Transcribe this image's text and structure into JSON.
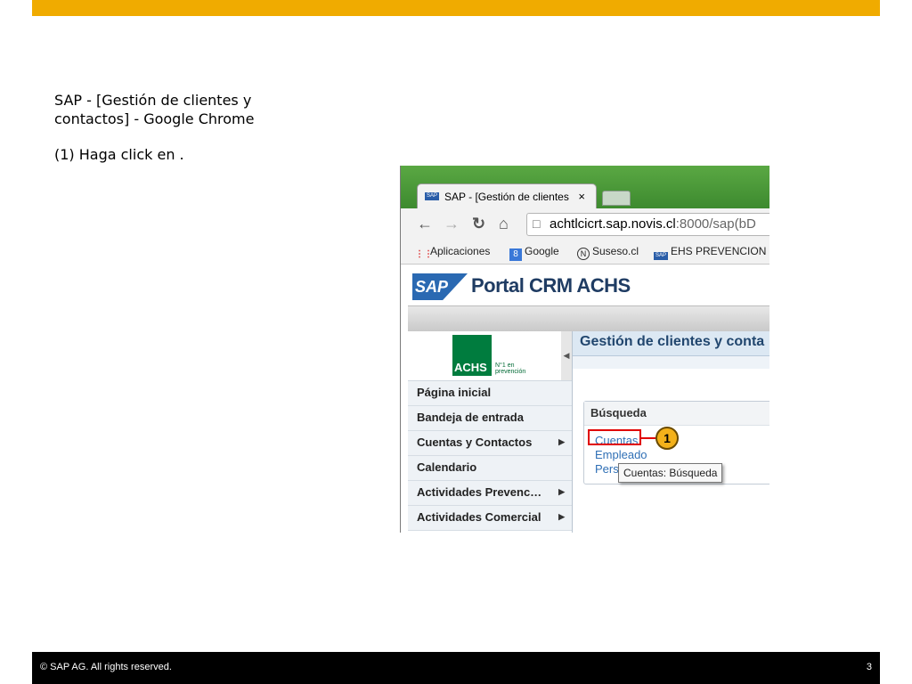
{
  "slide": {
    "title": "SAP - [Gestión de clientes y contactos] - Google Chrome",
    "instruction": "(1) Haga click en .",
    "footer_copyright": "©  SAP AG. All rights reserved.",
    "page_number": "3",
    "accent_color": "#f0ab00"
  },
  "browser": {
    "tab_icon": "SAP",
    "tab_title": "SAP - [Gestión de clientes",
    "tab_close": "×",
    "url_host": "achtlcicrt.sap.novis.cl",
    "url_rest": ":8000/sap(bD",
    "bookmarks": [
      {
        "label": "Aplicaciones",
        "icon": "apps-icon"
      },
      {
        "label": "Google",
        "icon": "google-icon"
      },
      {
        "label": "Suseso.cl",
        "icon": "suseso-icon"
      },
      {
        "label": "EHS PREVENCION",
        "icon": "sap-icon"
      }
    ]
  },
  "portal": {
    "logo_text": "SAP",
    "title": "Portal CRM ACHS",
    "achs_logo": "ACHS",
    "achs_tagline_1": "N°1 en",
    "achs_tagline_2": "prevención",
    "menu": [
      {
        "label": "Página inicial",
        "has_submenu": false
      },
      {
        "label": "Bandeja de entrada",
        "has_submenu": false
      },
      {
        "label": "Cuentas y Contactos",
        "has_submenu": true
      },
      {
        "label": "Calendario",
        "has_submenu": false
      },
      {
        "label": "Actividades Prevenc…",
        "has_submenu": true
      },
      {
        "label": "Actividades Comercial",
        "has_submenu": true
      }
    ],
    "page_title": "Gestión de clientes y conta",
    "search_header": "Búsqueda",
    "links": [
      "Cuentas",
      "Empleado",
      "Pers"
    ],
    "tooltip": "Cuentas: Búsqueda",
    "callout_number": "1"
  }
}
